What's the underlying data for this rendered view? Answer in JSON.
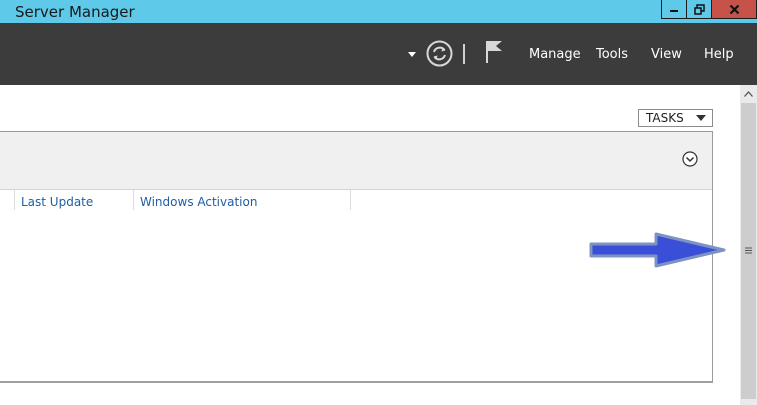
{
  "window": {
    "title": "Server Manager"
  },
  "toolbar": {
    "menu": {
      "manage": "Manage",
      "tools": "Tools",
      "view": "View",
      "help": "Help"
    }
  },
  "main": {
    "tasks_label": "TASKS",
    "columns": [
      "Last Update",
      "Windows Activation"
    ]
  },
  "colors": {
    "titlebar": "#5fc9ea",
    "toolbar": "#3c3c3c",
    "column_header_text": "#1e5ea8",
    "annotation_arrow": "#3a4fd8"
  },
  "icons": [
    "minimize-icon",
    "restore-icon",
    "close-icon",
    "dropdown-arrow-icon",
    "refresh-icon",
    "notification-flag-icon",
    "chevron-down-icon",
    "scroll-up-icon",
    "grip-icon",
    "arrow-annotation"
  ]
}
